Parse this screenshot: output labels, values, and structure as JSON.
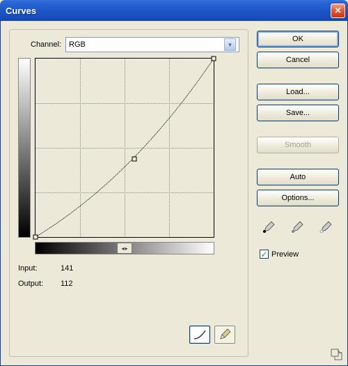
{
  "title": "Curves",
  "channel": {
    "label": "Channel:",
    "value": "RGB"
  },
  "input": {
    "label": "Input:",
    "value": "141"
  },
  "output": {
    "label": "Output:",
    "value": "112"
  },
  "buttons": {
    "ok": "OK",
    "cancel": "Cancel",
    "load": "Load...",
    "save": "Save...",
    "smooth": "Smooth",
    "auto": "Auto",
    "options": "Options..."
  },
  "preview": {
    "label": "Preview",
    "checked": true
  },
  "icons": {
    "close": "✕",
    "dropdown": "▾",
    "slider_left": "◂",
    "slider_right": "▸",
    "check": "✓"
  },
  "colors": {
    "titlebar_gradient_top": "#3b77dd",
    "titlebar_gradient_bottom": "#0f3da0",
    "close_red": "#d4421a",
    "dialog_bg": "#ece9d8",
    "button_border": "#003c74"
  },
  "chart_data": {
    "type": "line",
    "title": "Curves",
    "xlabel": "Input",
    "ylabel": "Output",
    "xlim": [
      0,
      255
    ],
    "ylim": [
      0,
      255
    ],
    "control_points": [
      {
        "input": 0,
        "output": 0
      },
      {
        "input": 141,
        "output": 112
      },
      {
        "input": 255,
        "output": 255
      }
    ],
    "grid_divisions": 4
  }
}
